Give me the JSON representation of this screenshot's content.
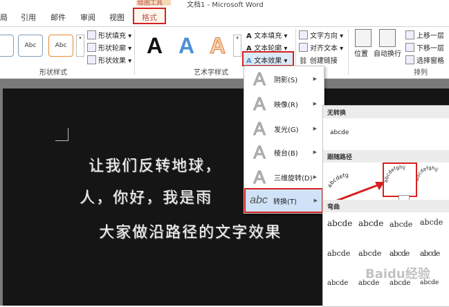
{
  "window": {
    "title": "文档1 - Microsoft Word",
    "contextual_group": "绘图工具"
  },
  "tabs": [
    "引用",
    "邮件",
    "审阅",
    "视图",
    "格式"
  ],
  "tab_partial": "局",
  "ribbon": {
    "shape_styles": {
      "swatches": [
        "Abc",
        "Abc"
      ],
      "fill": "形状填充",
      "outline": "形状轮廓",
      "effects": "形状效果",
      "group_label": "形状样式"
    },
    "wordart_styles": {
      "samples": [
        "A",
        "A",
        "A"
      ],
      "text_fill": "文本填充",
      "text_outline": "文本轮廓",
      "text_effects": "文本效果",
      "group_label": "艺术字样式"
    },
    "text": {
      "direction": "文字方向",
      "align": "对齐文本",
      "link": "创建链接"
    },
    "arrange": {
      "position": "位置",
      "wrap": "自动换行",
      "forward": "上移一层",
      "backward": "下移一层",
      "selection_pane": "选择窗格",
      "group_label": "排列"
    }
  },
  "document": {
    "lines": [
      "让我们反转地球，",
      "人，你好，我是雨",
      "大家做沿路径的文字效果"
    ]
  },
  "menu": {
    "items": [
      {
        "label": "阴影(S)",
        "icon": "A"
      },
      {
        "label": "映像(R)",
        "icon": "A"
      },
      {
        "label": "发光(G)",
        "icon": "A"
      },
      {
        "label": "棱台(B)",
        "icon": "A"
      },
      {
        "label": "三维旋转(D)",
        "icon": "A"
      },
      {
        "label": "转换(T)",
        "icon": "abc"
      }
    ]
  },
  "submenu": {
    "no_transform": "无转换",
    "no_transform_sample": "abcde",
    "follow_path": "跟随路径",
    "follow_samples": [
      "abcdefg",
      "abcdefghij",
      "abcdefghij"
    ],
    "warp": "弯曲",
    "warp_samples": [
      "abcde",
      "abcde",
      "abcde",
      "abcde",
      "abcde",
      "abcde",
      "abcde",
      "abcde",
      "abcde",
      "abcde",
      "abcde",
      "abcde"
    ],
    "watermark": "Baidu经验"
  },
  "colors": {
    "accent_red": "#d62020",
    "contextual": "#f3d9b8",
    "doc_bg": "#151515"
  }
}
